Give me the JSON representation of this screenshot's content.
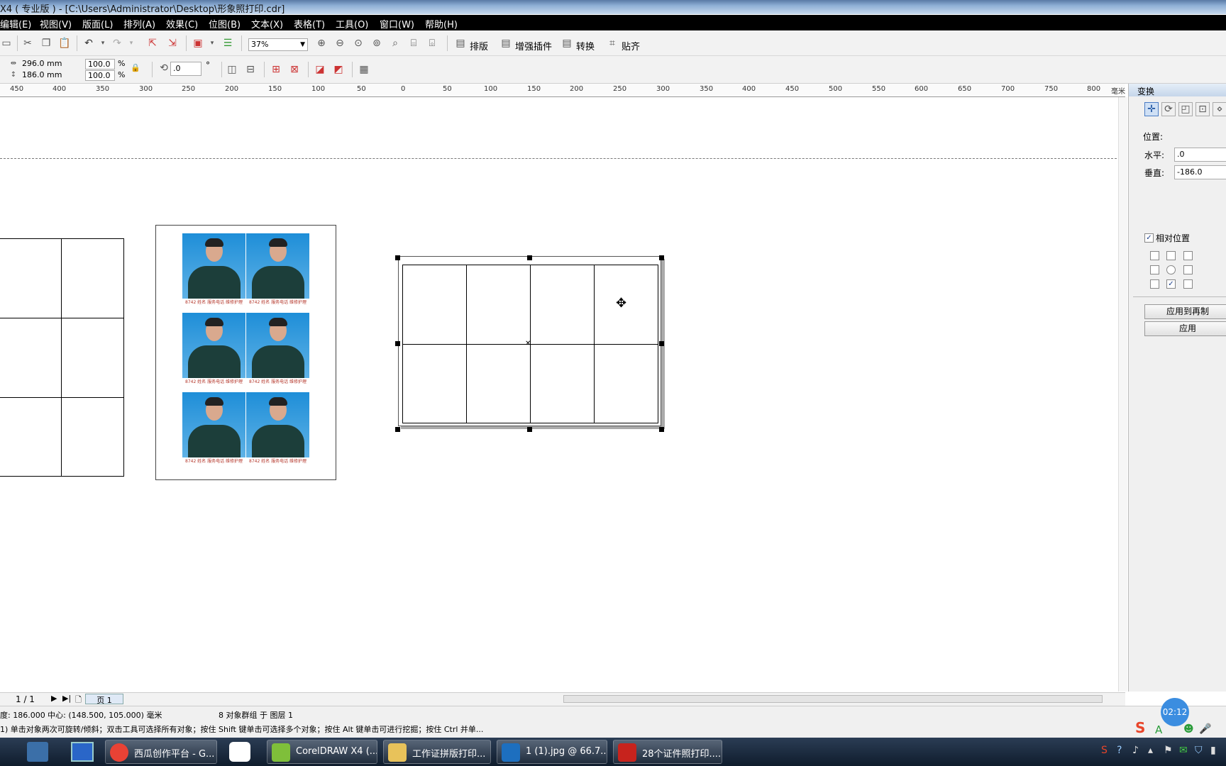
{
  "window": {
    "title": "X4 ( 专业版 ) - [C:\\Users\\Administrator\\Desktop\\形象照打印.cdr]"
  },
  "menu": [
    "编辑(E)",
    "视图(V)",
    "版面(L)",
    "排列(A)",
    "效果(C)",
    "位图(B)",
    "文本(X)",
    "表格(T)",
    "工具(O)",
    "窗口(W)",
    "帮助(H)"
  ],
  "toolbar": {
    "zoom": "37%",
    "paiban": "排版",
    "plugins": "增强插件",
    "convert": "转换",
    "snap": "贴齐"
  },
  "property_bar": {
    "width": "296.0 mm",
    "height": "186.0 mm",
    "scale_x": "100.0",
    "scale_y": "100.0",
    "pct": "%",
    "rotation": ".0",
    "degree": "°"
  },
  "ruler": {
    "labels": [
      "450",
      "400",
      "350",
      "300",
      "250",
      "200",
      "150",
      "100",
      "50",
      "0",
      "50",
      "100",
      "150",
      "200",
      "250",
      "300",
      "350",
      "400",
      "450",
      "500",
      "550",
      "600",
      "650",
      "700",
      "750",
      "800"
    ],
    "unit": "毫米"
  },
  "docker": {
    "title": "变换",
    "position_label": "位置:",
    "h_label": "水平:",
    "h_value": ".0",
    "v_label": "垂直:",
    "v_value": "-186.0",
    "relative_label": "相对位置",
    "apply_copy": "应用到再制",
    "apply": "应用"
  },
  "pagebar": {
    "count": "1 / 1",
    "tab": "页 1"
  },
  "status": {
    "line1_left": "度: 186.000  中心: (148.500, 105.000)  毫米",
    "line1_mid": "8 对象群组 于 图层 1",
    "line2": "1)   单击对象两次可旋转/倾斜；双击工具可选择所有对象；按住 Shift 键单击可选择多个对象；按住 Alt 键单击可进行挖掘；按住 Ctrl 并单...",
    "time": "02:12"
  },
  "taskbar": [
    {
      "label": "西瓜创作平台 - G...",
      "color": "#e94235"
    },
    {
      "label": "CorelDRAW X4 (...",
      "color": "#7fbf3a"
    },
    {
      "label": "工作证拼版打印...",
      "color": "#e8c25a"
    },
    {
      "label": "1 (1).jpg @ 66.7...",
      "color": "#1d6fbf"
    },
    {
      "label": "28个证件照打印....",
      "color": "#c7231d"
    }
  ],
  "photo_caption": "8742 姓名 服务电话 维修护理"
}
